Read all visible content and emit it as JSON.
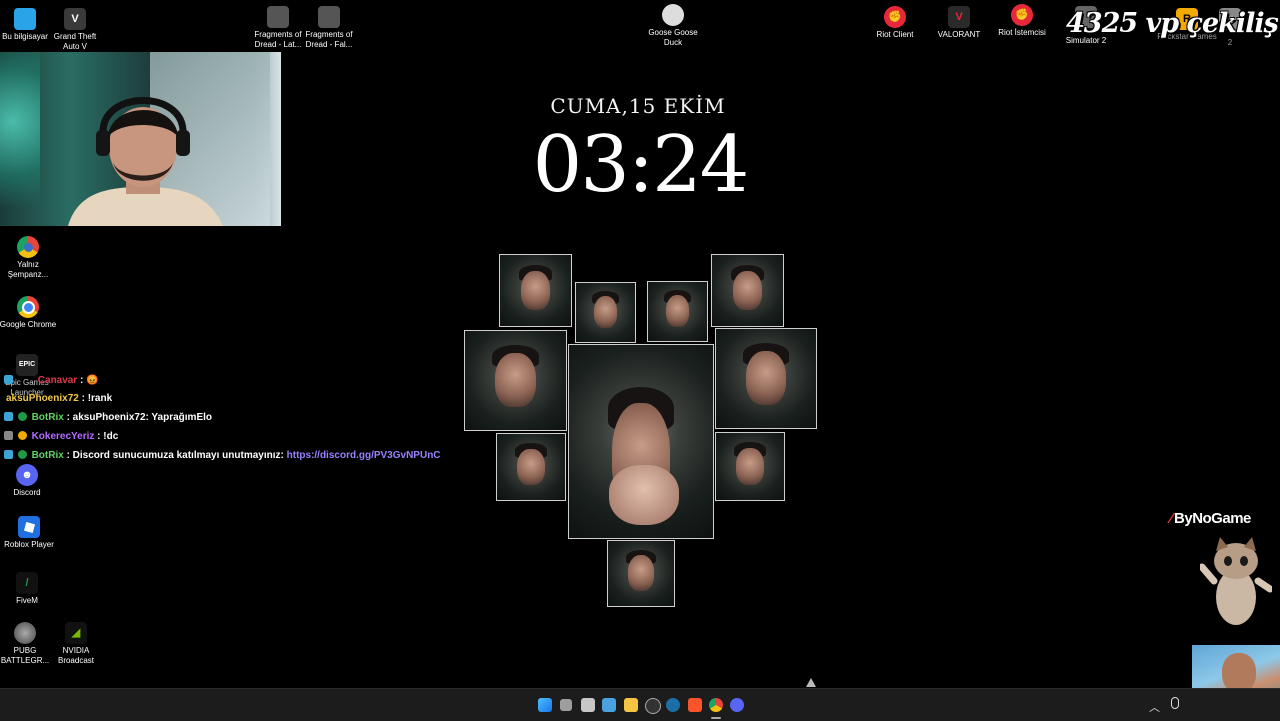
{
  "desktop_icons_left": [
    {
      "label": "Bu bilgisayar",
      "color": "#2aa4e8"
    },
    {
      "label": "Grand Theft Auto V",
      "color": "#3a3a3a"
    },
    {
      "label": "Yalnız Şempanz...",
      "color": "#3d6cc9"
    },
    {
      "label": "Google Chrome",
      "color": "#e8443a"
    },
    {
      "label": "Epic Games Launcher",
      "color": "#222222",
      "glyph": "EPIC"
    },
    {
      "label": "Discord",
      "color": "#5865f2"
    },
    {
      "label": "Roblox Player",
      "color": "#1f6fe0"
    },
    {
      "label": "FiveM",
      "color": "#1e9b45"
    },
    {
      "label": "PUBG BATTLEGR...",
      "color": "#7a7a7a"
    },
    {
      "label": "NVIDIA Broadcast",
      "color": "#76b900"
    }
  ],
  "desktop_icons_top": [
    {
      "label": "Fragments of Dread - Lat...",
      "color": "#555555"
    },
    {
      "label": "Fragments of Dread - Fal...",
      "color": "#555555"
    },
    {
      "label": "Goose Goose Duck",
      "color": "#dddddd"
    },
    {
      "label": "Riot Client",
      "color": "#e8283a"
    },
    {
      "label": "VALORANT",
      "color": "#e8283a"
    },
    {
      "label": "Riot İstemcisi",
      "color": "#e8283a"
    },
    {
      "label": "Simulator 2",
      "color": "#666666"
    },
    {
      "label": "Rockstar Games",
      "color": "#f2a900"
    },
    {
      "label": "2",
      "color": "#888888"
    }
  ],
  "overlay": {
    "title": "4325 vp çekiliş",
    "brand": "ByNoGame"
  },
  "clock": {
    "date": "CUMA,15 EKİM",
    "time": "03:24"
  },
  "chat": [
    {
      "user": "Canavar",
      "message": ": 😡",
      "user_color": "#e0384b"
    },
    {
      "user": "aksuPhoenix72",
      "message": ": !rank",
      "user_color": "#f2c94c"
    },
    {
      "user": "BotRix",
      "message": ": aksuPhoenix72: YaprağımElo",
      "user_color": "#5fd35f"
    },
    {
      "user": "KokerecYeriz",
      "message": ": !dc",
      "user_color": "#b36bff"
    },
    {
      "user": "BotRix",
      "message": ": Discord sunucumuza katılmayı unutmayınız: ",
      "link": "https://discord.gg/PV3GvNPUnC",
      "user_color": "#5fd35f"
    }
  ],
  "taskbar": {
    "icons": [
      "start-icon",
      "search-icon",
      "task-view-icon",
      "widgets-icon",
      "file-explorer-icon",
      "obs-icon",
      "steam-icon",
      "brave-icon",
      "chrome-icon",
      "discord-icon"
    ]
  }
}
